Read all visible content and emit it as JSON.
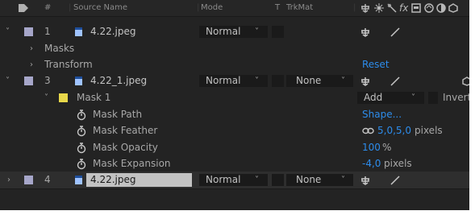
{
  "header": {
    "hash": "#",
    "source_name": "Source Name",
    "mode": "Mode",
    "t": "T",
    "trkmat": "TrkMat",
    "fx": "fx"
  },
  "layers": [
    {
      "num": "1",
      "name": "4.22.jpeg",
      "mode": "Normal"
    },
    {
      "num": "3",
      "name": "4.22_1.jpeg",
      "mode": "Normal",
      "trkmat": "None"
    },
    {
      "num": "4",
      "name": "4.22.jpeg",
      "mode": "Normal",
      "trkmat": "None"
    }
  ],
  "groups": {
    "masks": "Masks",
    "transform": "Transform",
    "reset": "Reset"
  },
  "mask": {
    "name": "Mask 1",
    "mode": "Add",
    "inverted": "Inverte",
    "color": "#e8d84a"
  },
  "mask_props": {
    "path_label": "Mask Path",
    "path_value": "Shape...",
    "feather_label": "Mask Feather",
    "feather_value": "5,0,5,0",
    "feather_unit": "pixels",
    "opacity_label": "Mask Opacity",
    "opacity_value": "100",
    "opacity_unit": "%",
    "expansion_label": "Mask Expansion",
    "expansion_value": "-4,0",
    "expansion_unit": "pixels"
  },
  "colors": {
    "accent": "#2d8ceb",
    "label_swatch": "#a6a6c9",
    "panel_bg": "#232323"
  },
  "icons": [
    "tag-icon",
    "shy-icon",
    "collapse-icon",
    "quality-icon",
    "fx-icon",
    "motion-blur-icon",
    "adjustment-icon",
    "3d-icon",
    "stopwatch-icon",
    "link-icon",
    "file-icon",
    "chevron-down-icon"
  ]
}
